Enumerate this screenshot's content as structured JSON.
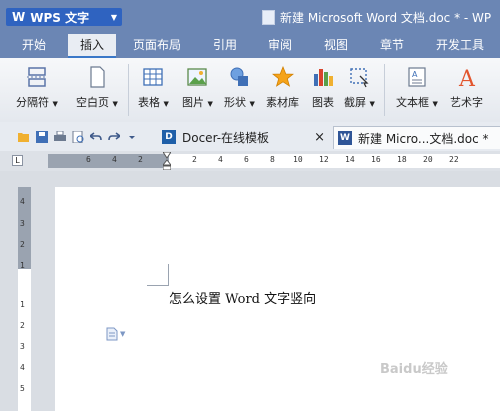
{
  "app": {
    "name": "WPS 文字"
  },
  "window": {
    "title": "新建 Microsoft Word 文档.doc * - WP"
  },
  "tabs": [
    "开始",
    "插入",
    "页面布局",
    "引用",
    "审阅",
    "视图",
    "章节",
    "开发工具"
  ],
  "active_tab": "插入",
  "ribbon": {
    "page_break": "分隔符",
    "blank_page": "空白页",
    "table": "表格",
    "picture": "图片",
    "shapes": "形状",
    "clipart": "素材库",
    "chart": "图表",
    "screenshot": "截屏",
    "textbox": "文本框",
    "wordart": "艺术字"
  },
  "doc_tabs": [
    {
      "label": "Docer-在线模板",
      "close": "×"
    },
    {
      "label": "新建 Micro...文档.doc *"
    }
  ],
  "ruler": {
    "corner_glyph": "L",
    "h_ticks": [
      "6",
      "4",
      "2",
      "2",
      "4",
      "6",
      "8",
      "10",
      "12",
      "14",
      "16",
      "18",
      "20",
      "22"
    ],
    "v_ticks": [
      "4",
      "3",
      "2",
      "1",
      "1",
      "2",
      "3",
      "4",
      "5"
    ]
  },
  "document": {
    "text": "怎么设置 Word 文字竖向"
  },
  "watermark": "Baidu经验",
  "colors": {
    "titlebar": "#6b86b4",
    "app_button": "#2f63c0",
    "active_tab_underline": "#3a78c8"
  }
}
